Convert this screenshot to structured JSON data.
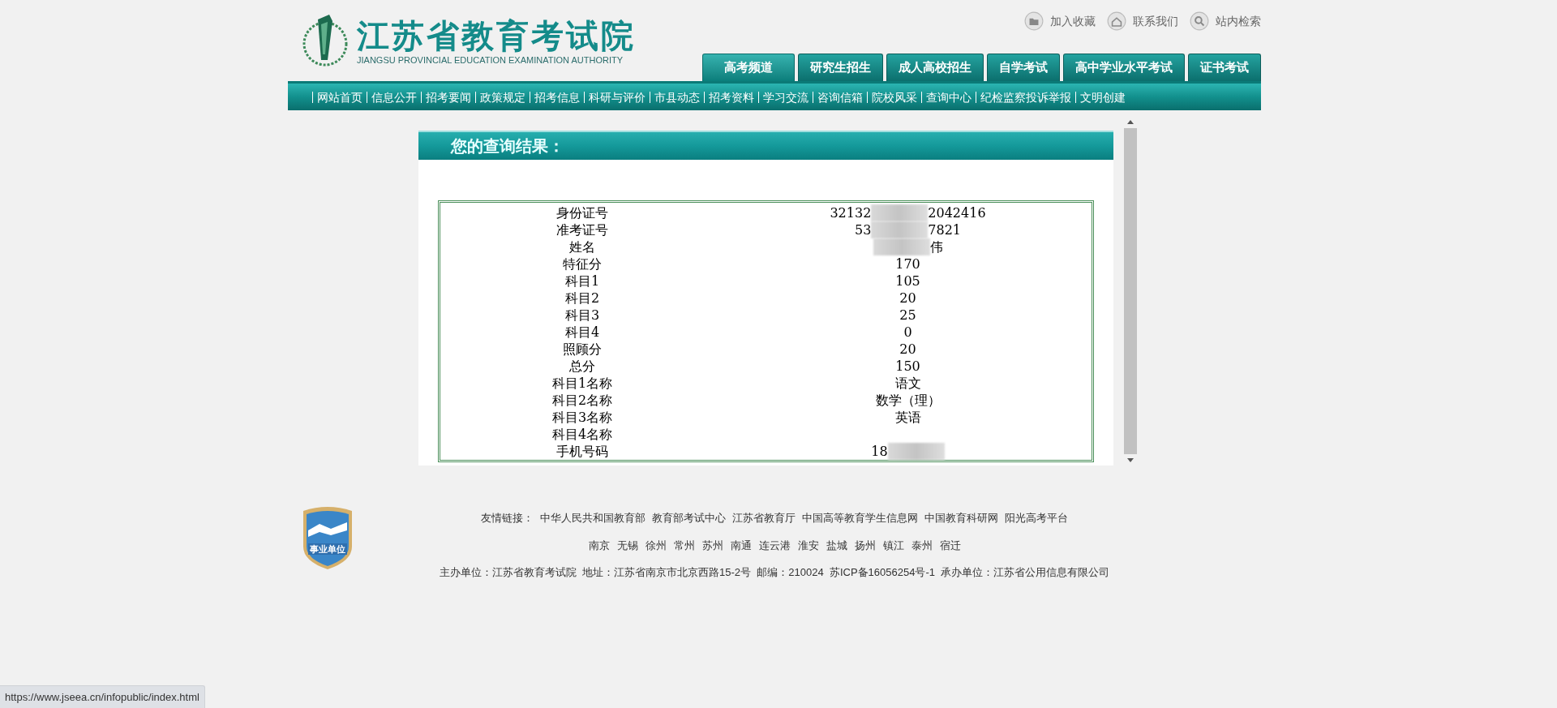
{
  "header": {
    "title": "江苏省教育考试院",
    "subtitle": "JIANGSU PROVINCIAL EDUCATION EXAMINATION AUTHORITY",
    "top_links": [
      {
        "kind": "folder",
        "label": "加入收藏"
      },
      {
        "kind": "home",
        "label": "联系我们"
      },
      {
        "kind": "search",
        "label": "站内检索"
      }
    ],
    "tabs": [
      {
        "label": "高考频道",
        "selected": true
      },
      {
        "label": "研究生招生",
        "selected": false
      },
      {
        "label": "成人高校招生",
        "selected": false
      },
      {
        "label": "自学考试",
        "selected": false
      },
      {
        "label": "高中学业水平考试",
        "selected": false
      },
      {
        "label": "证书考试",
        "selected": false
      }
    ]
  },
  "nav": [
    "网站首页",
    "信息公开",
    "招考要闻",
    "政策规定",
    "招考信息",
    "科研与评价",
    "市县动态",
    "招考资料",
    "学习交流",
    "咨询信箱",
    "院校风采",
    "查询中心",
    "纪检监察投诉举报",
    "文明创建"
  ],
  "result": {
    "title": "您的查询结果：",
    "rows": [
      {
        "label": "身份证号",
        "value": "32132",
        "value_end": "2042416",
        "blurred": true
      },
      {
        "label": "准考证号",
        "value": "53",
        "value_end": "7821",
        "blurred": true
      },
      {
        "label": "姓名",
        "value_end": "伟",
        "blurred": true
      },
      {
        "label": "特征分",
        "value": "170"
      },
      {
        "label": "科目1",
        "value": "105"
      },
      {
        "label": "科目2",
        "value": "20"
      },
      {
        "label": "科目3",
        "value": "25"
      },
      {
        "label": "科目4",
        "value": "0"
      },
      {
        "label": "照顾分",
        "value": "20"
      },
      {
        "label": "总分",
        "value": "150"
      },
      {
        "label": "科目1名称",
        "value": "语文"
      },
      {
        "label": "科目2名称",
        "value": "数学（理）"
      },
      {
        "label": "科目3名称",
        "value": "英语"
      },
      {
        "label": "科目4名称"
      },
      {
        "label": "手机号码",
        "value": "18",
        "blurred": true
      }
    ]
  },
  "footer": {
    "badge": "事业单位",
    "links_label": "友情链接：",
    "links": [
      "中华人民共和国教育部",
      "教育部考试中心",
      "江苏省教育厅",
      "中国高等教育学生信息网",
      "中国教育科研网",
      "阳光高考平台"
    ],
    "cities": [
      "南京",
      "无锡",
      "徐州",
      "常州",
      "苏州",
      "南通",
      "连云港",
      "淮安",
      "盐城",
      "扬州",
      "镇江",
      "泰州",
      "宿迁"
    ],
    "info": "主办单位：江苏省教育考试院  地址：江苏省南京市北京西路15-2号  邮编：210024  苏ICP备16056254号-1  承办单位：江苏省公用信息有限公司"
  },
  "status_url": "https://www.jseea.cn/infopublic/index.html"
}
